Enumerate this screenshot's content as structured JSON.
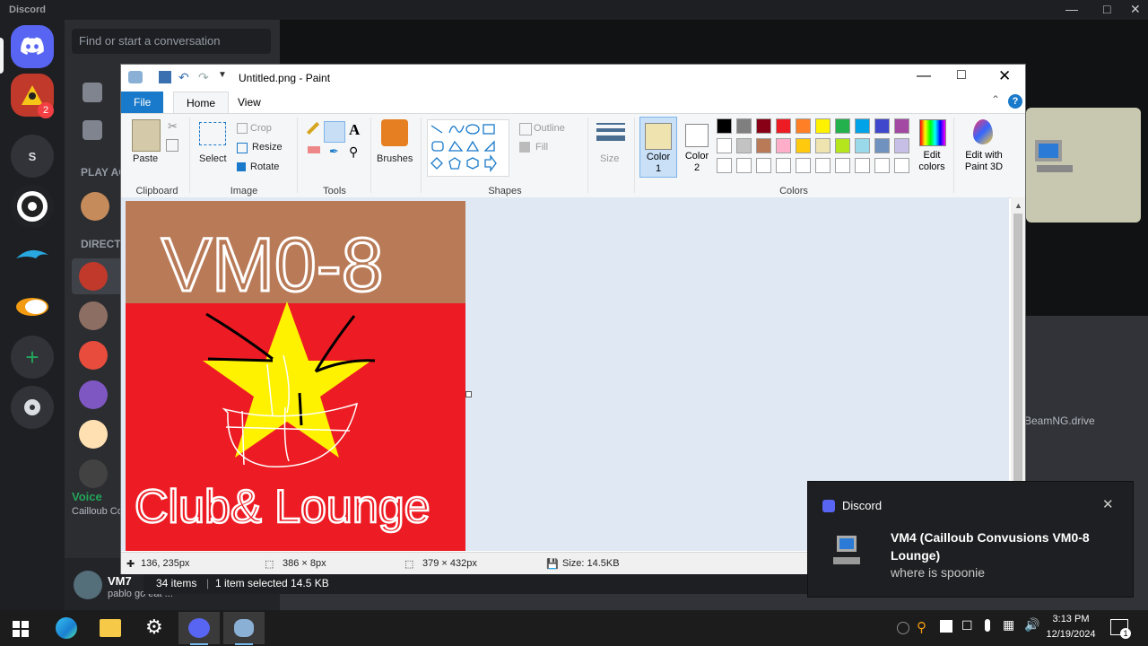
{
  "discord": {
    "app_name": "Discord",
    "search_placeholder": "Find or start a conversation",
    "section_play": "PLAY AC",
    "section_direct": "DIRECT",
    "guild_s": "S",
    "badge_count": "2",
    "voice_label": "Voice",
    "voice_sub": "Cailloub Co",
    "user_name": "VM7",
    "user_status": "pablo go eat ..."
  },
  "paint": {
    "title": "Untitled.png - Paint",
    "tabs": [
      "File",
      "Home",
      "View"
    ],
    "groups": {
      "clipboard": "Clipboard",
      "image": "Image",
      "tools": "Tools",
      "shapes": "Shapes",
      "colors": "Colors"
    },
    "buttons": {
      "paste": "Paste",
      "select": "Select",
      "crop": "Crop",
      "resize": "Resize",
      "rotate": "Rotate",
      "brushes": "Brushes",
      "outline": "Outline",
      "fill": "Fill",
      "size": "Size",
      "color1": "Color\n1",
      "color2": "Color\n2",
      "edit_colors": "Edit\ncolors",
      "edit_paint3d": "Edit with\nPaint 3D"
    },
    "color1": "#efe4b0",
    "color2": "#ffffff",
    "palette_row1": [
      "#000000",
      "#7f7f7f",
      "#880015",
      "#ed1c24",
      "#ff7f27",
      "#fff200",
      "#22b14c",
      "#00a2e8",
      "#3f48cc",
      "#a349a4"
    ],
    "palette_row2": [
      "#ffffff",
      "#c3c3c3",
      "#b97a57",
      "#ffaec9",
      "#ffc90e",
      "#efe4b0",
      "#b5e61d",
      "#99d9ea",
      "#7092be",
      "#c8bfe7"
    ],
    "status": {
      "cursor": "136, 235px",
      "selection": "386 × 8px",
      "image_size": "379 × 432px",
      "file_size": "Size: 14.5KB"
    },
    "drawing": {
      "top_text": "VM0-8",
      "bottom_text": "Club& Lounge",
      "top_color": "#b97a57",
      "flag_color": "#ed1c24",
      "star_color": "#fff200"
    }
  },
  "explorer_status": {
    "items": "34 items",
    "selected": "1 item selected  14.5 KB"
  },
  "behind": {
    "game_label": "BeamNG.drive"
  },
  "notification": {
    "app": "Discord",
    "title": "VM4 (Cailloub Convusions VM0-8 Lounge)",
    "message": "where is spoonie"
  },
  "taskbar": {
    "time": "3:13 PM",
    "date": "12/19/2024",
    "notif_count": "1"
  }
}
